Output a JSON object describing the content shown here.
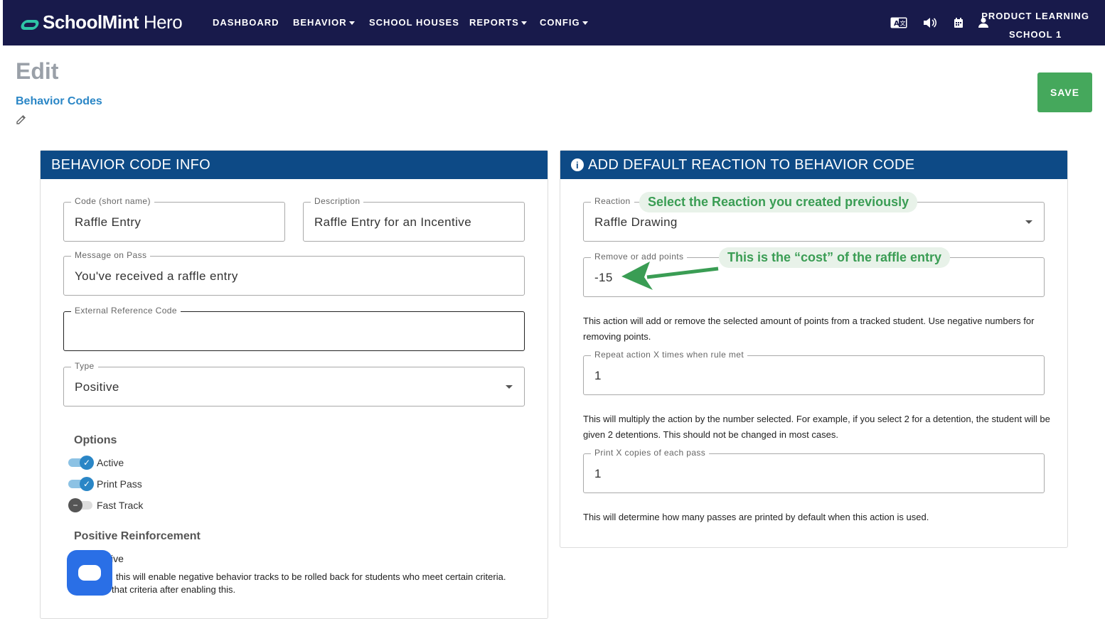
{
  "brand": {
    "name_bold": "SchoolMint",
    "name_light": " Hero"
  },
  "nav": {
    "dashboard": "DASHBOARD",
    "behavior": "BEHAVIOR",
    "school_houses": "SCHOOL HOUSES",
    "reports": "REPORTS",
    "config": "CONFIG"
  },
  "user": {
    "line1": "PRODUCT LEARNING",
    "line2": "SCHOOL 1"
  },
  "page": {
    "title": "Edit",
    "breadcrumb": "Behavior Codes",
    "save_label": "SAVE"
  },
  "left_card": {
    "header": "BEHAVIOR CODE INFO",
    "code": {
      "label": "Code (short name)",
      "value": "Raffle Entry"
    },
    "description": {
      "label": "Description",
      "value": "Raffle Entry for an Incentive"
    },
    "message": {
      "label": "Message on Pass",
      "value": "You've received a raffle entry"
    },
    "external_ref": {
      "label": "External Reference Code",
      "value": ""
    },
    "type": {
      "label": "Type",
      "value": "Positive"
    },
    "options_title": "Options",
    "options": [
      {
        "label": "Active",
        "on": true
      },
      {
        "label": "Print Pass",
        "on": true
      },
      {
        "label": "Fast Track",
        "on": false
      }
    ],
    "positive_title": "Positive Reinforcement",
    "positive_toggle_label": "ive",
    "positive_help_1": "this will enable negative behavior tracks to be rolled back for students who meet certain criteria.",
    "positive_help_2": "that criteria after enabling this."
  },
  "right_card": {
    "header": "ADD DEFAULT REACTION TO BEHAVIOR CODE",
    "reaction": {
      "label": "Reaction",
      "value": "Raffle Drawing"
    },
    "points": {
      "label": "Remove or add points",
      "value": "-15"
    },
    "points_help": "This action will add or remove the selected amount of points from a tracked student. Use negative numbers for removing points.",
    "repeat": {
      "label": "Repeat action X times when rule met",
      "value": "1"
    },
    "repeat_help": "This will multiply the action by the number selected. For example, if you select 2 for a detention, the student will be given 2 detentions. This should not be changed in most cases.",
    "copies": {
      "label": "Print X copies of each pass",
      "value": "1"
    },
    "copies_help": "This will determine how many passes are printed by default when this action is used."
  },
  "annotations": {
    "reaction_tip": "Select the Reaction you created previously",
    "points_tip": "This is the “cost” of the raffle entry"
  },
  "colors": {
    "nav_bg": "#181a4b",
    "card_header": "#0d4a86",
    "save": "#45a85c",
    "link": "#2a86c6",
    "annotation": "#3a9d54"
  }
}
